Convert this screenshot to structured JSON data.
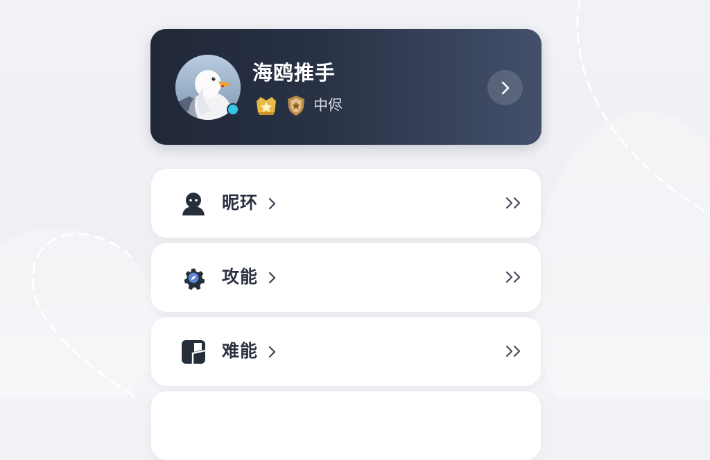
{
  "colors": {
    "card_gradient_start": "#1f2738",
    "card_gradient_end": "#43506b",
    "online_dot": "#36c6e6",
    "text_dark": "#2b3140",
    "icon_dark": "#262d3b",
    "gear_accent": "#5a86d6",
    "badge_gold": "#e9b948"
  },
  "profile": {
    "name": "海鸥推手",
    "level_text": "中侭",
    "avatar_icon": "seagull-avatar",
    "badges": [
      "gold-crown-badge-icon",
      "shield-star-badge-icon"
    ],
    "arrow_icon": "chevron-right-icon"
  },
  "menu": {
    "items": [
      {
        "label": "昵环",
        "icon": "person-icon"
      },
      {
        "label": "攻能",
        "icon": "gear-compass-icon"
      },
      {
        "label": "难能",
        "icon": "window-panel-icon"
      }
    ],
    "label_chevron_icon": "chevron-right-icon",
    "trailing_icon": "double-chevron-right-icon"
  }
}
